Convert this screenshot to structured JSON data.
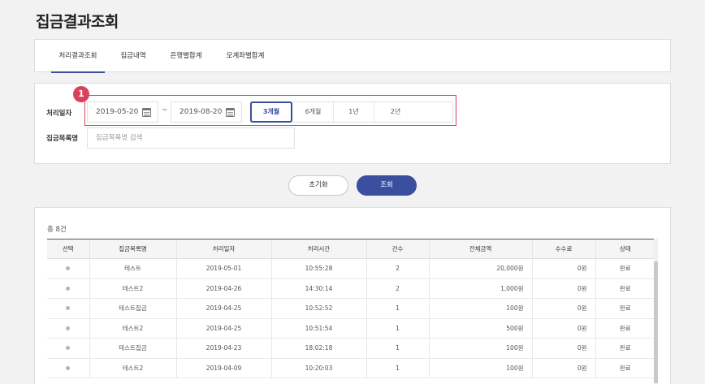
{
  "page": {
    "title": "집금결과조회"
  },
  "tabs": [
    {
      "label": "처리결과조회",
      "active": true
    },
    {
      "label": "집금내역",
      "active": false
    },
    {
      "label": "은행별합계",
      "active": false
    },
    {
      "label": "모계좌별합계",
      "active": false
    }
  ],
  "filter": {
    "badge": "1",
    "date_label": "처리일자",
    "start_date": "2019-05-20",
    "tilde": "~",
    "end_date": "2019-08-20",
    "periods": [
      {
        "label": "3개월",
        "active": true
      },
      {
        "label": "6개월",
        "active": false
      },
      {
        "label": "1년",
        "active": false
      },
      {
        "label": "2년",
        "active": false
      }
    ],
    "item_label": "집금목록명",
    "item_placeholder": "집금목록명 검색"
  },
  "buttons": {
    "reset": "초기화",
    "search": "조회"
  },
  "result": {
    "total": "총 8건",
    "columns": [
      "선택",
      "집금목록명",
      "처리일자",
      "처리시간",
      "건수",
      "전체금액",
      "수수료",
      "상태"
    ],
    "rows": [
      {
        "name": "테스트",
        "date": "2019-05-01",
        "time": "10:55:28",
        "count": "2",
        "amount": "20,000원",
        "fee": "0원",
        "status": "완료"
      },
      {
        "name": "테스트2",
        "date": "2019-04-26",
        "time": "14:30:14",
        "count": "2",
        "amount": "1,000원",
        "fee": "0원",
        "status": "완료"
      },
      {
        "name": "테스트집금",
        "date": "2019-04-25",
        "time": "10:52:52",
        "count": "1",
        "amount": "100원",
        "fee": "0원",
        "status": "완료"
      },
      {
        "name": "테스트2",
        "date": "2019-04-25",
        "time": "10:51:54",
        "count": "1",
        "amount": "500원",
        "fee": "0원",
        "status": "완료"
      },
      {
        "name": "테스트집금",
        "date": "2019-04-23",
        "time": "18:02:18",
        "count": "1",
        "amount": "100원",
        "fee": "0원",
        "status": "완료"
      },
      {
        "name": "테스트2",
        "date": "2019-04-09",
        "time": "10:20:03",
        "count": "1",
        "amount": "100원",
        "fee": "0원",
        "status": "완료"
      }
    ]
  },
  "colors": {
    "accent": "#3a4f9e",
    "highlight": "#d9425a"
  }
}
